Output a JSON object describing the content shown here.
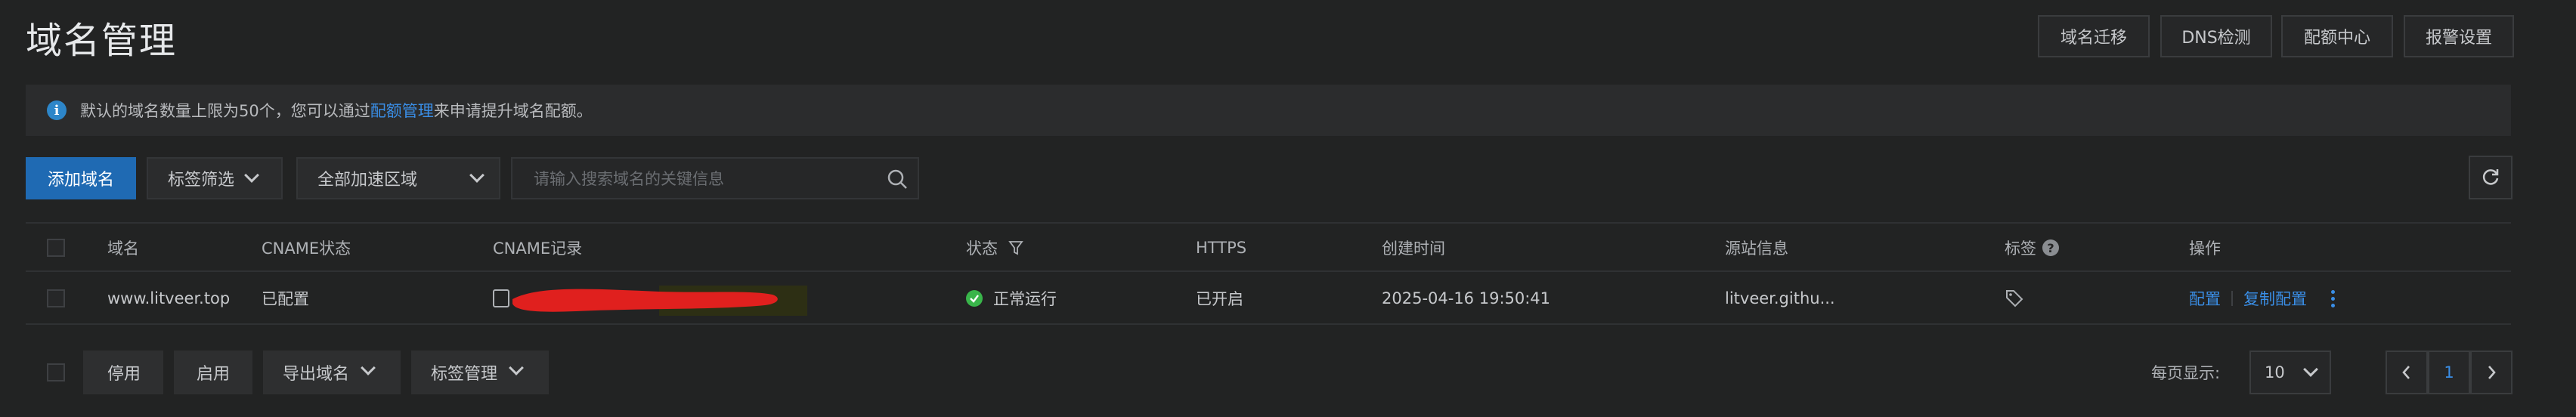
{
  "header": {
    "title": "域名管理",
    "buttons": [
      "域名迁移",
      "DNS检测",
      "配额中心",
      "报警设置"
    ]
  },
  "notice": {
    "icon": "info-icon",
    "text_before": "默认的域名数量上限为50个，您可以通过",
    "link": "配额管理",
    "text_after": "来申请提升域名配额。"
  },
  "toolbar": {
    "add_label": "添加域名",
    "tag_filter": "标签筛选",
    "region": "全部加速区域",
    "search_placeholder": "请输入搜索域名的关键信息"
  },
  "table": {
    "headers": {
      "domain": "域名",
      "cname_status": "CNAME状态",
      "cname_record": "CNAME记录",
      "status": "状态",
      "https": "HTTPS",
      "created": "创建时间",
      "origin": "源站信息",
      "tags": "标签",
      "ops": "操作"
    },
    "rows": [
      {
        "domain": "www.litveer.top",
        "cname_status": "已配置",
        "status": "正常运行",
        "https": "已开启",
        "created": "2025-04-16 19:50:41",
        "origin": "litveer.githu...",
        "op_config": "配置",
        "op_copy": "复制配置"
      }
    ]
  },
  "footer": {
    "disable": "停用",
    "enable": "启用",
    "export": "导出域名",
    "tag_manage": "标签管理",
    "page_size_label": "每页显示:",
    "page_size": "10",
    "current_page": "1"
  },
  "colors": {
    "accent": "#1f6ab3",
    "link": "#3a8ee6",
    "success": "#39b54a",
    "redaction": "#e0201e"
  }
}
